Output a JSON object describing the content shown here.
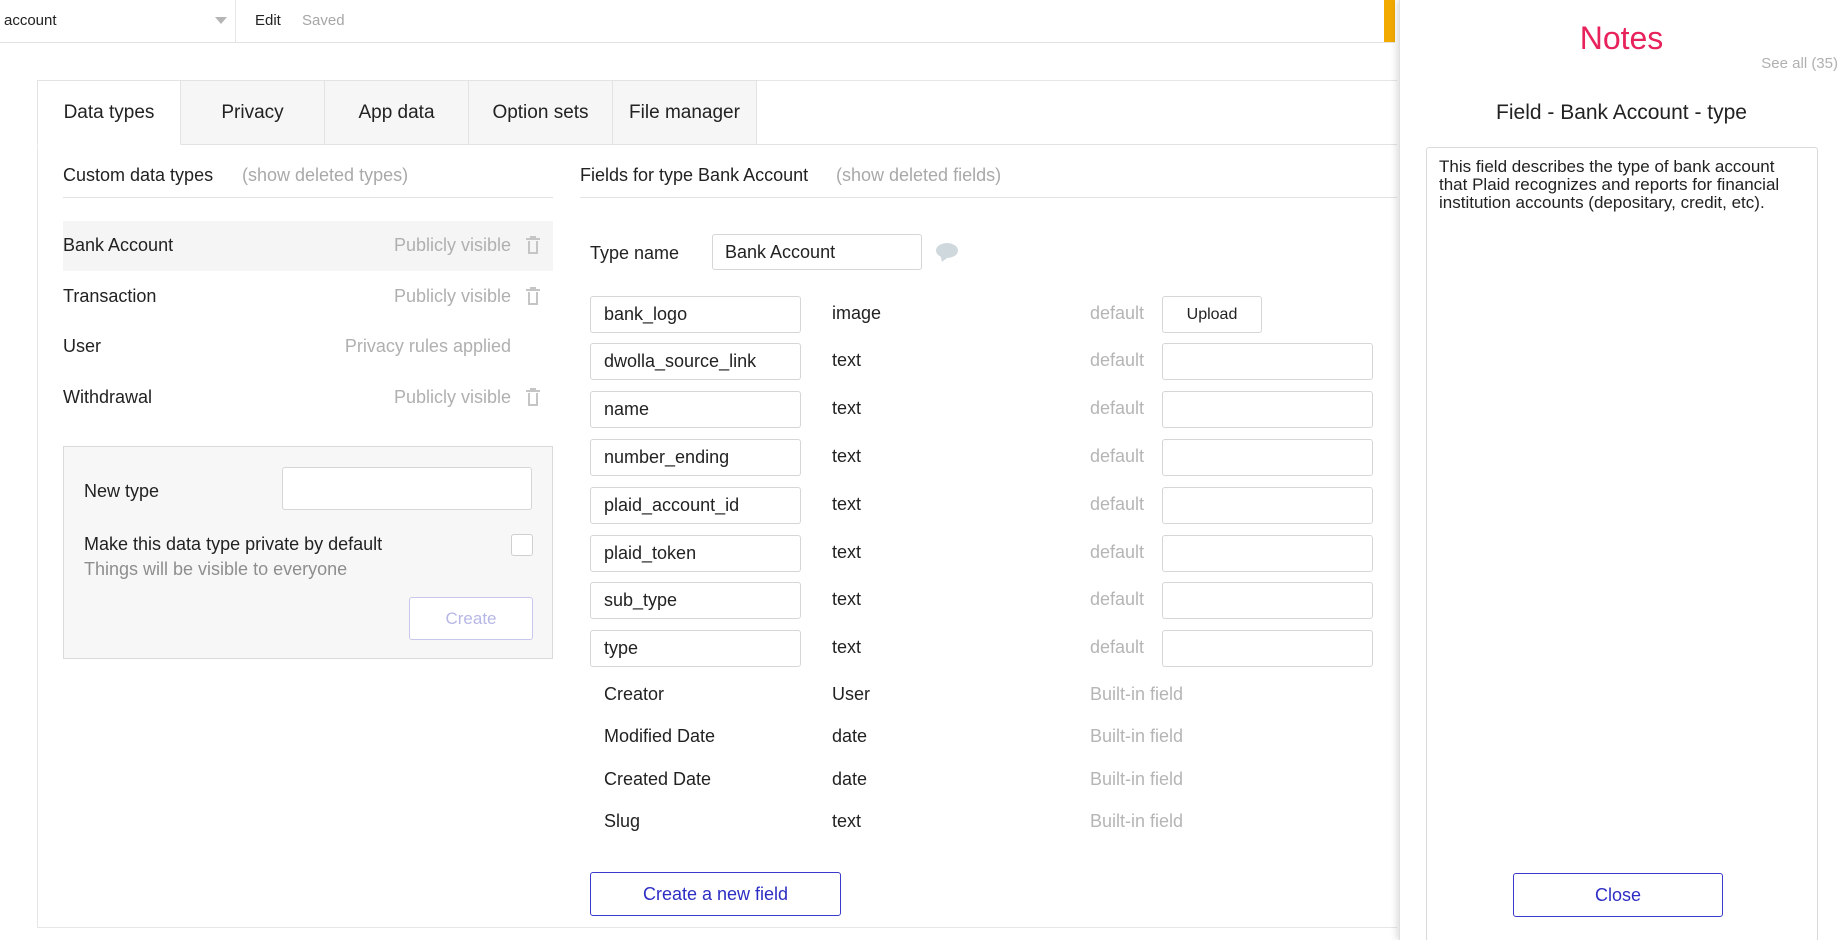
{
  "topbar": {
    "page_name": "account",
    "edit_label": "Edit",
    "saved_label": "Saved"
  },
  "tabs": [
    {
      "label": "Data types",
      "active": true
    },
    {
      "label": "Privacy",
      "active": false
    },
    {
      "label": "App data",
      "active": false
    },
    {
      "label": "Option sets",
      "active": false
    },
    {
      "label": "File manager",
      "active": false
    }
  ],
  "custom_types": {
    "title": "Custom data types",
    "show_deleted": "(show deleted types)",
    "items": [
      {
        "name": "Bank Account",
        "visibility": "Publicly visible",
        "selected": true
      },
      {
        "name": "Transaction",
        "visibility": "Publicly visible",
        "selected": false
      },
      {
        "name": "User",
        "visibility": "Privacy rules applied",
        "selected": false
      },
      {
        "name": "Withdrawal",
        "visibility": "Publicly visible",
        "selected": false
      }
    ]
  },
  "new_type": {
    "label": "New type",
    "input_value": "",
    "private_label": "Make this data type private by default",
    "hint": "Things will be visible to everyone",
    "create_label": "Create"
  },
  "fields": {
    "title": "Fields for type Bank Account",
    "show_deleted": "(show deleted fields)",
    "type_name_label": "Type name",
    "type_name_value": "Bank Account",
    "default_label": "default",
    "upload_label": "Upload",
    "items": [
      {
        "name": "bank_logo",
        "type": "image"
      },
      {
        "name": "dwolla_source_link",
        "type": "text"
      },
      {
        "name": "name",
        "type": "text"
      },
      {
        "name": "number_ending",
        "type": "text"
      },
      {
        "name": "plaid_account_id",
        "type": "text"
      },
      {
        "name": "plaid_token",
        "type": "text"
      },
      {
        "name": "sub_type",
        "type": "text"
      },
      {
        "name": "type",
        "type": "text"
      }
    ],
    "builtin": [
      {
        "name": "Creator",
        "type": "User",
        "note": "Built-in field"
      },
      {
        "name": "Modified Date",
        "type": "date",
        "note": "Built-in field"
      },
      {
        "name": "Created Date",
        "type": "date",
        "note": "Built-in field"
      },
      {
        "name": "Slug",
        "type": "text",
        "note": "Built-in field"
      }
    ],
    "create_label": "Create a new field"
  },
  "notes": {
    "title": "Notes",
    "see_all": "See all (35)",
    "subtitle": "Field - Bank Account - type",
    "text": "This field describes the type of bank account that Plaid recognizes and reports for financial institution accounts (depositary, credit, etc).",
    "close_label": "Close"
  },
  "colors": {
    "notes_title": "#e8235c",
    "primary_button": "#2d2dc4",
    "accent_strip": "#f2a900"
  }
}
